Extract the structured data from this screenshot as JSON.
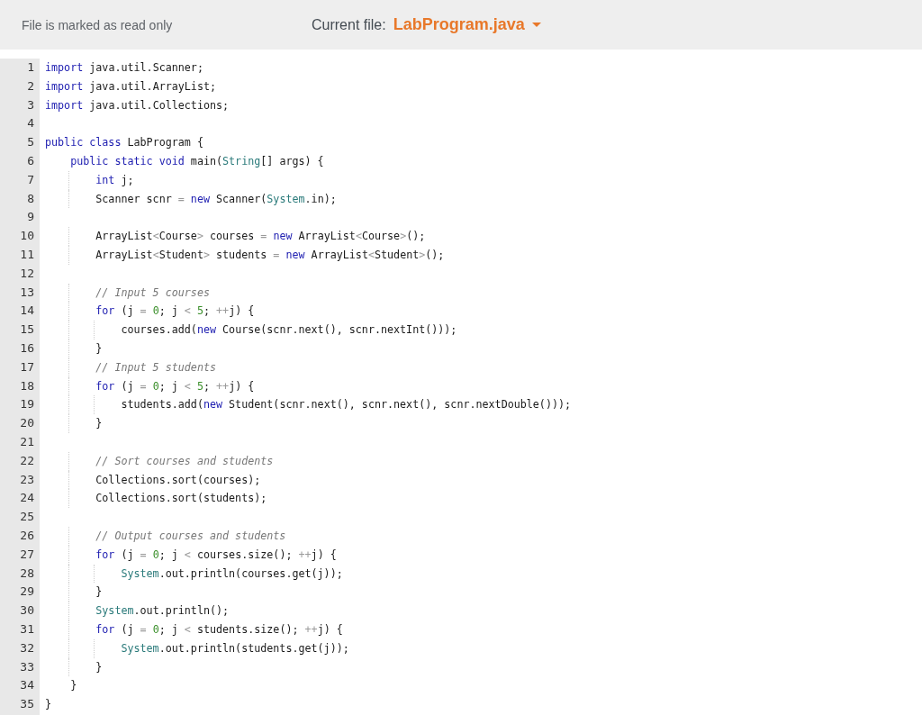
{
  "header": {
    "notice": "File is marked as read only",
    "current_file_label": "Current file:",
    "file_name": "LabProgram.java"
  },
  "editor": {
    "lines": [
      {
        "number": "1",
        "tokens": [
          {
            "kind": "keyword",
            "text": "import"
          },
          {
            "kind": "plain",
            "text": " java.util.Scanner;"
          }
        ]
      },
      {
        "number": "2",
        "tokens": [
          {
            "kind": "keyword",
            "text": "import"
          },
          {
            "kind": "plain",
            "text": " java.util.ArrayList;"
          }
        ]
      },
      {
        "number": "3",
        "tokens": [
          {
            "kind": "keyword",
            "text": "import"
          },
          {
            "kind": "plain",
            "text": " java.util.Collections;"
          }
        ]
      },
      {
        "number": "4"
      },
      {
        "number": "5",
        "tokens": [
          {
            "kind": "keyword",
            "text": "public class"
          },
          {
            "kind": "plain",
            "text": " LabProgram {"
          }
        ]
      },
      {
        "number": "6",
        "tokens": [
          {
            "kind": "keyword",
            "text": "    public static void"
          },
          {
            "kind": "plain",
            "text": " main("
          },
          {
            "kind": "type",
            "text": "String"
          },
          {
            "kind": "plain",
            "text": "[] args) {"
          }
        ]
      },
      {
        "number": "7",
        "tokens": [
          {
            "kind": "keyword",
            "text": "        int"
          },
          {
            "kind": "plain",
            "text": " j;"
          }
        ]
      },
      {
        "number": "8",
        "tokens": [
          {
            "kind": "plain",
            "text": "        Scanner scnr "
          },
          {
            "kind": "operator",
            "text": "="
          },
          {
            "kind": "keyword",
            "text": " new"
          },
          {
            "kind": "plain",
            "text": " Scanner("
          },
          {
            "kind": "type",
            "text": "System"
          },
          {
            "kind": "plain",
            "text": ".in);"
          }
        ]
      },
      {
        "number": "9"
      },
      {
        "number": "10",
        "tokens": [
          {
            "kind": "plain",
            "text": "        ArrayList"
          },
          {
            "kind": "operator",
            "text": "<"
          },
          {
            "kind": "plain",
            "text": "Course"
          },
          {
            "kind": "operator",
            "text": ">"
          },
          {
            "kind": "plain",
            "text": " courses "
          },
          {
            "kind": "operator",
            "text": "="
          },
          {
            "kind": "keyword",
            "text": " new"
          },
          {
            "kind": "plain",
            "text": " ArrayList"
          },
          {
            "kind": "operator",
            "text": "<"
          },
          {
            "kind": "plain",
            "text": "Course"
          },
          {
            "kind": "operator",
            "text": ">"
          },
          {
            "kind": "plain",
            "text": "();"
          }
        ]
      },
      {
        "number": "11",
        "tokens": [
          {
            "kind": "plain",
            "text": "        ArrayList"
          },
          {
            "kind": "operator",
            "text": "<"
          },
          {
            "kind": "plain",
            "text": "Student"
          },
          {
            "kind": "operator",
            "text": ">"
          },
          {
            "kind": "plain",
            "text": " students "
          },
          {
            "kind": "operator",
            "text": "="
          },
          {
            "kind": "keyword",
            "text": " new"
          },
          {
            "kind": "plain",
            "text": " ArrayList"
          },
          {
            "kind": "operator",
            "text": "<"
          },
          {
            "kind": "plain",
            "text": "Student"
          },
          {
            "kind": "operator",
            "text": ">"
          },
          {
            "kind": "plain",
            "text": "();"
          }
        ]
      },
      {
        "number": "12"
      },
      {
        "number": "13",
        "tokens": [
          {
            "kind": "comment",
            "text": "        // Input 5 courses"
          }
        ]
      },
      {
        "number": "14",
        "tokens": [
          {
            "kind": "keyword",
            "text": "        for"
          },
          {
            "kind": "plain",
            "text": " (j "
          },
          {
            "kind": "operator",
            "text": "="
          },
          {
            "kind": "number",
            "text": " 0"
          },
          {
            "kind": "plain",
            "text": "; j "
          },
          {
            "kind": "operator",
            "text": "<"
          },
          {
            "kind": "number",
            "text": " 5"
          },
          {
            "kind": "plain",
            "text": "; "
          },
          {
            "kind": "operator",
            "text": "++"
          },
          {
            "kind": "plain",
            "text": "j) {"
          }
        ]
      },
      {
        "number": "15",
        "tokens": [
          {
            "kind": "plain",
            "text": "            courses.add("
          },
          {
            "kind": "keyword",
            "text": "new"
          },
          {
            "kind": "plain",
            "text": " Course(scnr.next(), scnr.nextInt()));"
          }
        ]
      },
      {
        "number": "16",
        "tokens": [
          {
            "kind": "plain",
            "text": "        }"
          }
        ]
      },
      {
        "number": "17",
        "tokens": [
          {
            "kind": "comment",
            "text": "        // Input 5 students"
          }
        ]
      },
      {
        "number": "18",
        "tokens": [
          {
            "kind": "keyword",
            "text": "        for"
          },
          {
            "kind": "plain",
            "text": " (j "
          },
          {
            "kind": "operator",
            "text": "="
          },
          {
            "kind": "number",
            "text": " 0"
          },
          {
            "kind": "plain",
            "text": "; j "
          },
          {
            "kind": "operator",
            "text": "<"
          },
          {
            "kind": "number",
            "text": " 5"
          },
          {
            "kind": "plain",
            "text": "; "
          },
          {
            "kind": "operator",
            "text": "++"
          },
          {
            "kind": "plain",
            "text": "j) {"
          }
        ]
      },
      {
        "number": "19",
        "tokens": [
          {
            "kind": "plain",
            "text": "            students.add("
          },
          {
            "kind": "keyword",
            "text": "new"
          },
          {
            "kind": "plain",
            "text": " Student(scnr.next(), scnr.next(), scnr.nextDouble()));"
          }
        ]
      },
      {
        "number": "20",
        "tokens": [
          {
            "kind": "plain",
            "text": "        }"
          }
        ]
      },
      {
        "number": "21"
      },
      {
        "number": "22",
        "tokens": [
          {
            "kind": "comment",
            "text": "        // Sort courses and students"
          }
        ]
      },
      {
        "number": "23",
        "tokens": [
          {
            "kind": "plain",
            "text": "        Collections.sort(courses);"
          }
        ]
      },
      {
        "number": "24",
        "tokens": [
          {
            "kind": "plain",
            "text": "        Collections.sort(students);"
          }
        ]
      },
      {
        "number": "25"
      },
      {
        "number": "26",
        "tokens": [
          {
            "kind": "comment",
            "text": "        // Output courses and students"
          }
        ]
      },
      {
        "number": "27",
        "tokens": [
          {
            "kind": "keyword",
            "text": "        for"
          },
          {
            "kind": "plain",
            "text": " (j "
          },
          {
            "kind": "operator",
            "text": "="
          },
          {
            "kind": "number",
            "text": " 0"
          },
          {
            "kind": "plain",
            "text": "; j "
          },
          {
            "kind": "operator",
            "text": "<"
          },
          {
            "kind": "plain",
            "text": " courses.size(); "
          },
          {
            "kind": "operator",
            "text": "++"
          },
          {
            "kind": "plain",
            "text": "j) {"
          }
        ]
      },
      {
        "number": "28",
        "tokens": [
          {
            "kind": "type",
            "text": "            System"
          },
          {
            "kind": "plain",
            "text": ".out.println(courses.get(j));"
          }
        ]
      },
      {
        "number": "29",
        "tokens": [
          {
            "kind": "plain",
            "text": "        }"
          }
        ]
      },
      {
        "number": "30",
        "tokens": [
          {
            "kind": "type",
            "text": "        System"
          },
          {
            "kind": "plain",
            "text": ".out.println();"
          }
        ]
      },
      {
        "number": "31",
        "tokens": [
          {
            "kind": "keyword",
            "text": "        for"
          },
          {
            "kind": "plain",
            "text": " (j "
          },
          {
            "kind": "operator",
            "text": "="
          },
          {
            "kind": "number",
            "text": " 0"
          },
          {
            "kind": "plain",
            "text": "; j "
          },
          {
            "kind": "operator",
            "text": "<"
          },
          {
            "kind": "plain",
            "text": " students.size(); "
          },
          {
            "kind": "operator",
            "text": "++"
          },
          {
            "kind": "plain",
            "text": "j) {"
          }
        ]
      },
      {
        "number": "32",
        "tokens": [
          {
            "kind": "type",
            "text": "            System"
          },
          {
            "kind": "plain",
            "text": ".out.println(students.get(j));"
          }
        ]
      },
      {
        "number": "33",
        "tokens": [
          {
            "kind": "plain",
            "text": "        }"
          }
        ]
      },
      {
        "number": "34",
        "tokens": [
          {
            "kind": "plain",
            "text": "    }"
          }
        ]
      },
      {
        "number": "35",
        "tokens": [
          {
            "kind": "plain",
            "text": "}"
          }
        ]
      }
    ]
  }
}
